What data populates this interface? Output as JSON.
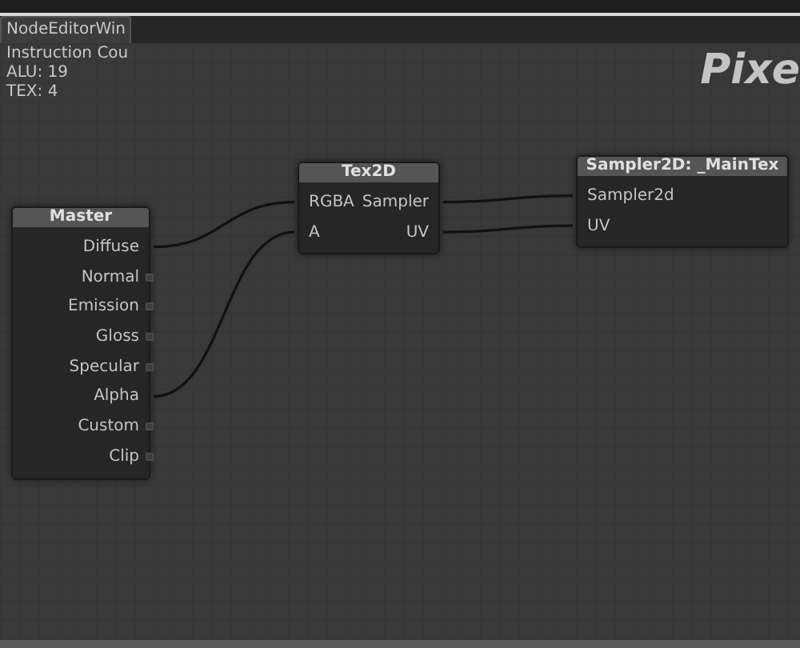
{
  "tab": {
    "label": "NodeEditorWin",
    "selected": true
  },
  "stats": [
    "Instruction Cou",
    "ALU: 19",
    "TEX: 4"
  ],
  "heading": "Pixe",
  "nodes": [
    {
      "title": "Master",
      "rows": [
        {
          "right": "Diffuse",
          "right_connected": true
        },
        {
          "right": "Normal",
          "right_connected": false
        },
        {
          "right": "Emission",
          "right_connected": false
        },
        {
          "right": "Gloss",
          "right_connected": false
        },
        {
          "right": "Specular",
          "right_connected": false
        },
        {
          "right": "Alpha",
          "right_connected": true
        },
        {
          "right": "Custom",
          "right_connected": false
        },
        {
          "right": "Clip",
          "right_connected": false
        }
      ]
    },
    {
      "title": "Tex2D",
      "rows": [
        {
          "left": "RGBA",
          "left_connected": true,
          "right": "Sampler",
          "right_connected": true
        },
        {
          "left": "A",
          "left_connected": true,
          "right": "UV",
          "right_connected": true
        }
      ]
    },
    {
      "title": "Sampler2D: _MainTex",
      "rows": [
        {
          "left": "Sampler2d",
          "left_connected": true
        },
        {
          "left": "UV",
          "left_connected": true
        }
      ]
    }
  ]
}
